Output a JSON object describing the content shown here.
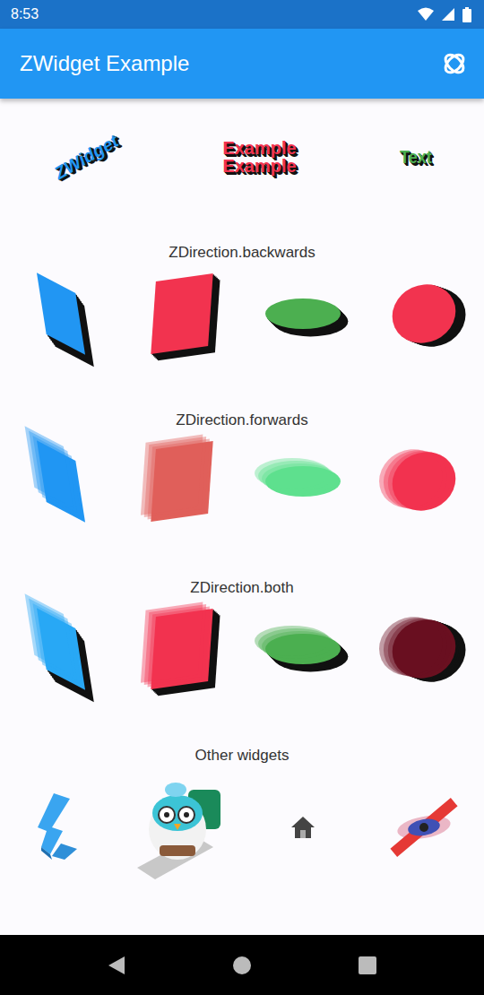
{
  "status_bar": {
    "time": "8:53"
  },
  "app_bar": {
    "title": "ZWidget Example"
  },
  "hero": [
    {
      "text": "ZWidget",
      "color": "#2196f3",
      "kind": "tilted"
    },
    {
      "text": "Example",
      "color": "#f2334f",
      "kind": "stacked"
    },
    {
      "text": "Text",
      "color": "#4caf50",
      "kind": "flat"
    }
  ],
  "sections": [
    {
      "title": "ZDirection.backwards",
      "direction": "backwards",
      "shapes": [
        {
          "kind": "panel",
          "color": "#2196f3"
        },
        {
          "kind": "card",
          "color": "#f2334f"
        },
        {
          "kind": "disc",
          "color": "#4caf50"
        },
        {
          "kind": "coin",
          "color": "#f2334f"
        }
      ]
    },
    {
      "title": "ZDirection.forwards",
      "direction": "forwards",
      "shapes": [
        {
          "kind": "panel",
          "color": "#2196f3"
        },
        {
          "kind": "card",
          "color": "#e0605a"
        },
        {
          "kind": "disc",
          "color": "#5ee08e"
        },
        {
          "kind": "coin",
          "color": "#f2334f"
        }
      ]
    },
    {
      "title": "ZDirection.both",
      "direction": "both",
      "shapes": [
        {
          "kind": "panel",
          "color": "#29a8f5"
        },
        {
          "kind": "card",
          "color": "#f2334f"
        },
        {
          "kind": "disc",
          "color": "#4caf50"
        },
        {
          "kind": "coin",
          "color": "#6a1020"
        }
      ]
    }
  ],
  "other": {
    "title": "Other widgets",
    "items": [
      {
        "kind": "logo"
      },
      {
        "kind": "picture"
      },
      {
        "kind": "home"
      },
      {
        "kind": "cross"
      }
    ]
  }
}
